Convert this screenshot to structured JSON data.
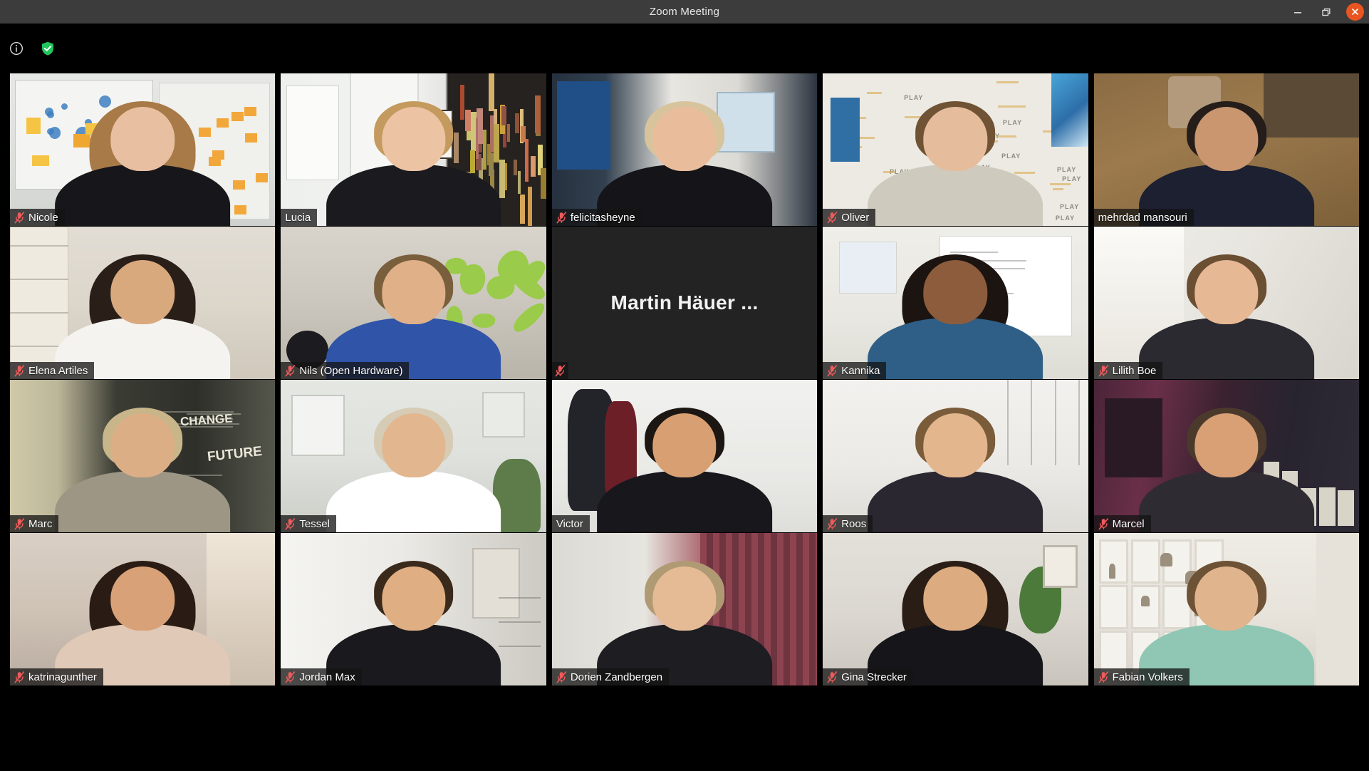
{
  "window": {
    "title": "Zoom Meeting",
    "controls": {
      "minimize": "Minimize",
      "maximize": "Restore",
      "close": "Close"
    }
  },
  "header": {
    "info_icon": "info-icon",
    "encryption_icon": "shield-check-icon"
  },
  "colors": {
    "active_speaker_border": "#d9ec4b",
    "titlebar_background": "#3c3c3c",
    "app_background": "#000000",
    "close_button": "#e95420",
    "mic_muted": "#f05b5b"
  },
  "gallery": {
    "columns": 5,
    "rows": 4,
    "participants": [
      {
        "name": "Nicole",
        "muted": true,
        "active_speaker": false,
        "video_on": true,
        "scene": "sc-nicole"
      },
      {
        "name": "Lucia",
        "muted": false,
        "active_speaker": true,
        "video_on": true,
        "scene": "sc-lucia"
      },
      {
        "name": "felicitasheyne",
        "muted": true,
        "active_speaker": false,
        "video_on": true,
        "scene": "sc-fel"
      },
      {
        "name": "Oliver",
        "muted": true,
        "active_speaker": false,
        "video_on": true,
        "scene": "sc-oliver"
      },
      {
        "name": "mehrdad mansouri",
        "muted": false,
        "active_speaker": false,
        "video_on": true,
        "scene": "sc-mehrdad"
      },
      {
        "name": "Elena Artiles",
        "muted": true,
        "active_speaker": false,
        "video_on": true,
        "scene": "sc-elena"
      },
      {
        "name": "Nils (Open Hardware)",
        "muted": true,
        "active_speaker": false,
        "video_on": true,
        "scene": "sc-nils"
      },
      {
        "name": "Martin Häuer ...",
        "muted": true,
        "active_speaker": false,
        "video_on": false,
        "scene": ""
      },
      {
        "name": "Kannika",
        "muted": true,
        "active_speaker": false,
        "video_on": true,
        "scene": "sc-kannika"
      },
      {
        "name": "Lilith Boe",
        "muted": true,
        "active_speaker": false,
        "video_on": true,
        "scene": "sc-lilith"
      },
      {
        "name": "Marc",
        "muted": true,
        "active_speaker": false,
        "video_on": true,
        "scene": "sc-marc"
      },
      {
        "name": "Tessel",
        "muted": true,
        "active_speaker": false,
        "video_on": true,
        "scene": "sc-tessel"
      },
      {
        "name": "Victor",
        "muted": false,
        "active_speaker": false,
        "video_on": true,
        "scene": "sc-victor"
      },
      {
        "name": "Roos",
        "muted": true,
        "active_speaker": false,
        "video_on": true,
        "scene": "sc-roos"
      },
      {
        "name": "Marcel",
        "muted": true,
        "active_speaker": false,
        "video_on": true,
        "scene": "sc-marcel"
      },
      {
        "name": "katrinagunther",
        "muted": true,
        "active_speaker": false,
        "video_on": true,
        "scene": "sc-katrina"
      },
      {
        "name": "Jordan Max",
        "muted": true,
        "active_speaker": false,
        "video_on": true,
        "scene": "sc-jordan"
      },
      {
        "name": "Dorien Zandbergen",
        "muted": true,
        "active_speaker": false,
        "video_on": true,
        "scene": "sc-dorien"
      },
      {
        "name": "Gina Strecker",
        "muted": true,
        "active_speaker": false,
        "video_on": true,
        "scene": "sc-gina"
      },
      {
        "name": "Fabian Volkers",
        "muted": true,
        "active_speaker": false,
        "video_on": true,
        "scene": "sc-fabian"
      }
    ]
  }
}
